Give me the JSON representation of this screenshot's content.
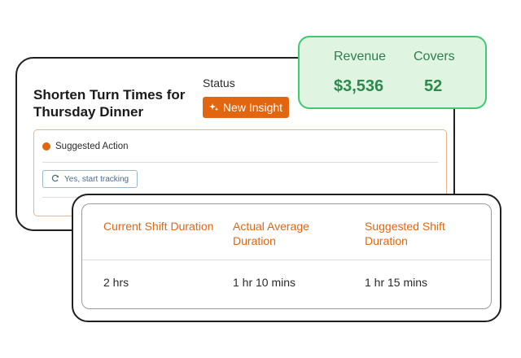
{
  "insight": {
    "title": "Shorten Turn Times for Thursday Dinner",
    "status_label": "Status",
    "status_badge": "New Insight",
    "suggested_action_label": "Suggested Action",
    "track_button_label": "Yes, start tracking"
  },
  "metrics": {
    "revenue_label": "Revenue",
    "revenue_value": "$3,536",
    "covers_label": "Covers",
    "covers_value": "52"
  },
  "duration_table": {
    "headers": [
      "Current Shift Duration",
      "Actual Average Duration",
      "Suggested Shift Duration"
    ],
    "values": [
      "2 hrs",
      "1 hr 10 mins",
      "1 hr 15 mins"
    ]
  },
  "colors": {
    "accent_orange": "#e2660f",
    "metric_green": "#2b8a4c",
    "metric_bg": "#dff5e1"
  }
}
